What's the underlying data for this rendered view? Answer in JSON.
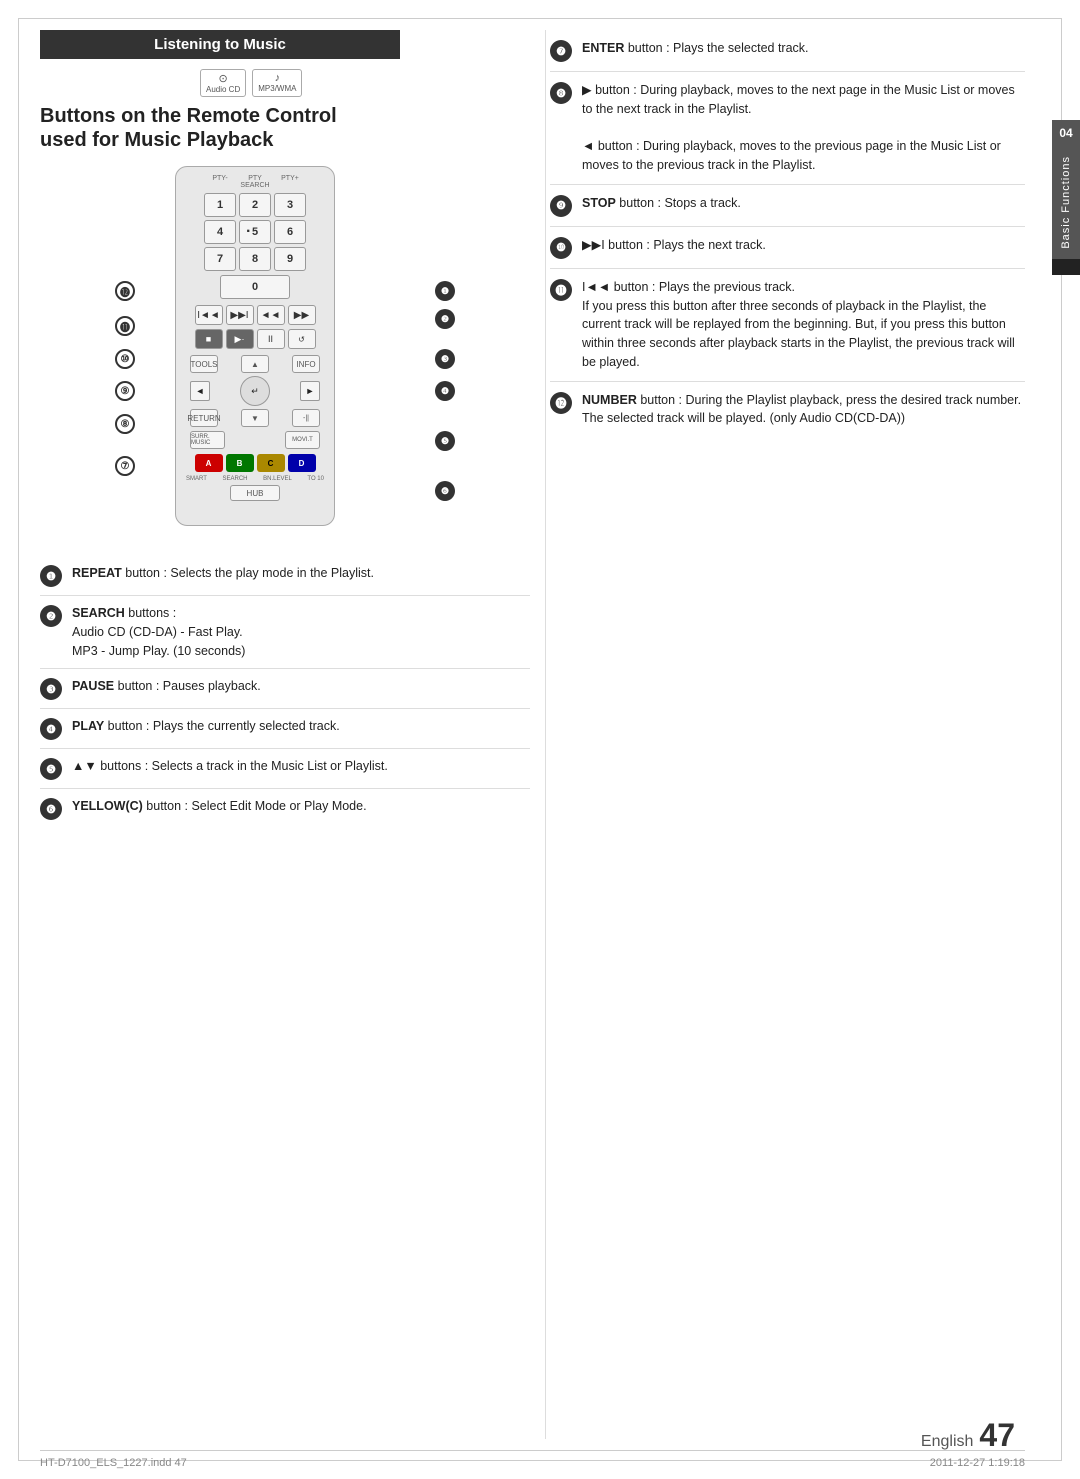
{
  "page": {
    "title": "Listening to Music",
    "subtitle1": "Buttons on the Remote Control",
    "subtitle2": "used for Music Playback",
    "chapter": "04",
    "chapter_label": "Basic Functions",
    "page_word": "English",
    "page_number": "47",
    "footer_left": "HT-D7100_ELS_1227.indd  47",
    "footer_right": "2011-12-27   1:19:18"
  },
  "media_icons": [
    {
      "symbol": "⊙",
      "label": "Audio CD"
    },
    {
      "symbol": "♪",
      "label": "MP3/WMA"
    }
  ],
  "remote": {
    "num_labels": [
      "PTY-",
      "PTY SEARCH",
      "PTY+"
    ],
    "nums": [
      "1",
      "2",
      "3",
      "4",
      "·5",
      "6",
      "7",
      "8",
      "9",
      "0"
    ],
    "transport": [
      "I◄◄",
      "▶▶I",
      "◄◄",
      "▶▶"
    ],
    "playback": [
      "■",
      "▶·",
      "II",
      ""
    ],
    "dpad_up": "▲",
    "dpad_down": "▼",
    "dpad_left": "◄",
    "dpad_right": "►",
    "dpad_center": "↵",
    "colors": [
      "A",
      "B",
      "C",
      "D"
    ],
    "color_values": [
      "#e00",
      "#090",
      "#ee0",
      "#00a"
    ],
    "top_labels": [
      "TOOLS",
      "INFO"
    ],
    "bottom_labels": [
      "RETURN",
      "MUTE"
    ],
    "smart_label": "SMART SEARCH BN.LEVEL TO 10",
    "hub_label": "HUB"
  },
  "callouts_left": {
    "c12": "⓬",
    "c11": "⓫",
    "c10": "⑩",
    "c9": "⑨",
    "c8": "⑧",
    "c7": "⑦",
    "c1": "❶",
    "c2": "❷",
    "c3": "❸",
    "c4": "❹",
    "c5": "❺",
    "c6": "❻"
  },
  "bottom_items": [
    {
      "num": "❶",
      "bold": "REPEAT",
      "text": " button : Selects the play mode in the Playlist."
    },
    {
      "num": "❷",
      "bold": "SEARCH",
      "text": " buttons :\nAudio CD (CD-DA) - Fast Play.\nMP3 - Jump Play. (10 seconds)"
    },
    {
      "num": "❸",
      "bold": "PAUSE",
      "text": " button : Pauses playback."
    },
    {
      "num": "❹",
      "bold": "PLAY",
      "text": " button : Plays the currently selected track."
    },
    {
      "num": "❺",
      "bold": "▲▼",
      "text": " buttons : Selects a track in the Music List or Playlist."
    },
    {
      "num": "❻",
      "bold": "YELLOW(C)",
      "text": " button : Select Edit Mode or Play Mode."
    }
  ],
  "right_items": [
    {
      "num": "❼",
      "bold": "ENTER",
      "text": " button : Plays the selected track."
    },
    {
      "num": "❽",
      "text": "▶ button : During playback, moves to the next page in the Music List or moves to the next track in the Playlist.\n◄ button : During playback, moves to the previous page in the Music List or moves to the previous track in the Playlist."
    },
    {
      "num": "❾",
      "bold": "STOP",
      "text": " button : Stops a track."
    },
    {
      "num": "❿",
      "text": "▶▶I button : Plays the next track."
    },
    {
      "num": "⓫",
      "text": "I◄◄ button : Plays the previous track.\nIf you press this button after three seconds of playback in the Playlist, the current track will be replayed from the beginning. But, if you press this button within three seconds after playback starts in the Playlist, the previous track will be played."
    },
    {
      "num": "⓬",
      "bold": "NUMBER",
      "text": " button : During the Playlist playback, press the desired track number. The selected track will be played. (only Audio CD(CD-DA))"
    }
  ]
}
